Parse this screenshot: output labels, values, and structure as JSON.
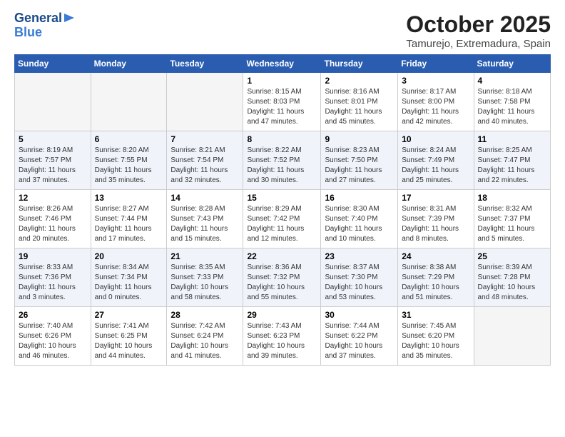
{
  "header": {
    "logo_line1": "General",
    "logo_line2": "Blue",
    "month": "October 2025",
    "location": "Tamurejo, Extremadura, Spain"
  },
  "weekdays": [
    "Sunday",
    "Monday",
    "Tuesday",
    "Wednesday",
    "Thursday",
    "Friday",
    "Saturday"
  ],
  "weeks": [
    [
      {
        "day": "",
        "info": ""
      },
      {
        "day": "",
        "info": ""
      },
      {
        "day": "",
        "info": ""
      },
      {
        "day": "1",
        "info": "Sunrise: 8:15 AM\nSunset: 8:03 PM\nDaylight: 11 hours\nand 47 minutes."
      },
      {
        "day": "2",
        "info": "Sunrise: 8:16 AM\nSunset: 8:01 PM\nDaylight: 11 hours\nand 45 minutes."
      },
      {
        "day": "3",
        "info": "Sunrise: 8:17 AM\nSunset: 8:00 PM\nDaylight: 11 hours\nand 42 minutes."
      },
      {
        "day": "4",
        "info": "Sunrise: 8:18 AM\nSunset: 7:58 PM\nDaylight: 11 hours\nand 40 minutes."
      }
    ],
    [
      {
        "day": "5",
        "info": "Sunrise: 8:19 AM\nSunset: 7:57 PM\nDaylight: 11 hours\nand 37 minutes."
      },
      {
        "day": "6",
        "info": "Sunrise: 8:20 AM\nSunset: 7:55 PM\nDaylight: 11 hours\nand 35 minutes."
      },
      {
        "day": "7",
        "info": "Sunrise: 8:21 AM\nSunset: 7:54 PM\nDaylight: 11 hours\nand 32 minutes."
      },
      {
        "day": "8",
        "info": "Sunrise: 8:22 AM\nSunset: 7:52 PM\nDaylight: 11 hours\nand 30 minutes."
      },
      {
        "day": "9",
        "info": "Sunrise: 8:23 AM\nSunset: 7:50 PM\nDaylight: 11 hours\nand 27 minutes."
      },
      {
        "day": "10",
        "info": "Sunrise: 8:24 AM\nSunset: 7:49 PM\nDaylight: 11 hours\nand 25 minutes."
      },
      {
        "day": "11",
        "info": "Sunrise: 8:25 AM\nSunset: 7:47 PM\nDaylight: 11 hours\nand 22 minutes."
      }
    ],
    [
      {
        "day": "12",
        "info": "Sunrise: 8:26 AM\nSunset: 7:46 PM\nDaylight: 11 hours\nand 20 minutes."
      },
      {
        "day": "13",
        "info": "Sunrise: 8:27 AM\nSunset: 7:44 PM\nDaylight: 11 hours\nand 17 minutes."
      },
      {
        "day": "14",
        "info": "Sunrise: 8:28 AM\nSunset: 7:43 PM\nDaylight: 11 hours\nand 15 minutes."
      },
      {
        "day": "15",
        "info": "Sunrise: 8:29 AM\nSunset: 7:42 PM\nDaylight: 11 hours\nand 12 minutes."
      },
      {
        "day": "16",
        "info": "Sunrise: 8:30 AM\nSunset: 7:40 PM\nDaylight: 11 hours\nand 10 minutes."
      },
      {
        "day": "17",
        "info": "Sunrise: 8:31 AM\nSunset: 7:39 PM\nDaylight: 11 hours\nand 8 minutes."
      },
      {
        "day": "18",
        "info": "Sunrise: 8:32 AM\nSunset: 7:37 PM\nDaylight: 11 hours\nand 5 minutes."
      }
    ],
    [
      {
        "day": "19",
        "info": "Sunrise: 8:33 AM\nSunset: 7:36 PM\nDaylight: 11 hours\nand 3 minutes."
      },
      {
        "day": "20",
        "info": "Sunrise: 8:34 AM\nSunset: 7:34 PM\nDaylight: 11 hours\nand 0 minutes."
      },
      {
        "day": "21",
        "info": "Sunrise: 8:35 AM\nSunset: 7:33 PM\nDaylight: 10 hours\nand 58 minutes."
      },
      {
        "day": "22",
        "info": "Sunrise: 8:36 AM\nSunset: 7:32 PM\nDaylight: 10 hours\nand 55 minutes."
      },
      {
        "day": "23",
        "info": "Sunrise: 8:37 AM\nSunset: 7:30 PM\nDaylight: 10 hours\nand 53 minutes."
      },
      {
        "day": "24",
        "info": "Sunrise: 8:38 AM\nSunset: 7:29 PM\nDaylight: 10 hours\nand 51 minutes."
      },
      {
        "day": "25",
        "info": "Sunrise: 8:39 AM\nSunset: 7:28 PM\nDaylight: 10 hours\nand 48 minutes."
      }
    ],
    [
      {
        "day": "26",
        "info": "Sunrise: 7:40 AM\nSunset: 6:26 PM\nDaylight: 10 hours\nand 46 minutes."
      },
      {
        "day": "27",
        "info": "Sunrise: 7:41 AM\nSunset: 6:25 PM\nDaylight: 10 hours\nand 44 minutes."
      },
      {
        "day": "28",
        "info": "Sunrise: 7:42 AM\nSunset: 6:24 PM\nDaylight: 10 hours\nand 41 minutes."
      },
      {
        "day": "29",
        "info": "Sunrise: 7:43 AM\nSunset: 6:23 PM\nDaylight: 10 hours\nand 39 minutes."
      },
      {
        "day": "30",
        "info": "Sunrise: 7:44 AM\nSunset: 6:22 PM\nDaylight: 10 hours\nand 37 minutes."
      },
      {
        "day": "31",
        "info": "Sunrise: 7:45 AM\nSunset: 6:20 PM\nDaylight: 10 hours\nand 35 minutes."
      },
      {
        "day": "",
        "info": ""
      }
    ]
  ]
}
